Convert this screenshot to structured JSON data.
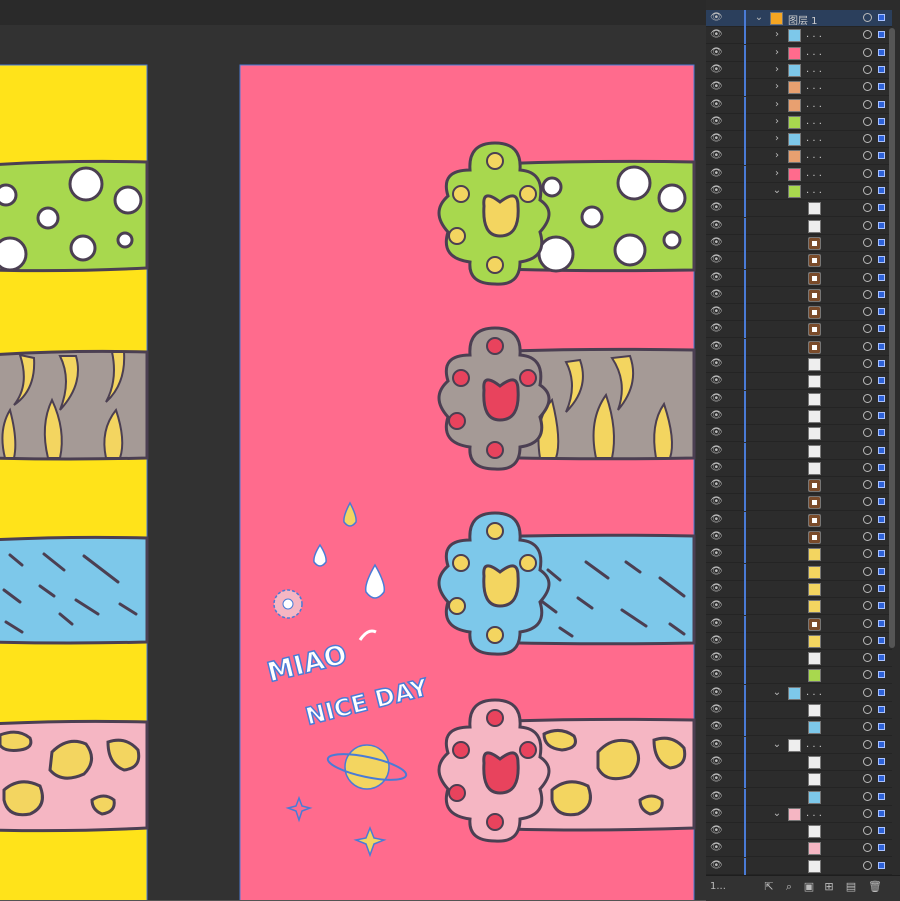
{
  "colors": {
    "canvas_bg": "#323232",
    "artboard_left": "#ffe31a",
    "artboard_right": "#ff6b8d",
    "green_arm": "#a8d84e",
    "gray_arm": "#a59a96",
    "blue_arm": "#7dc8ea",
    "pink_arm": "#f5b6c3",
    "paw_yellow": "#f3d560",
    "paw_red": "#e8435d",
    "selection_blue": "#4a7bd6"
  },
  "artwork": {
    "miao_text": "MIAO",
    "niceday_text": "NICE DAY"
  },
  "layers_panel": {
    "top_layer_name": "图层 1",
    "collapsed_name": ". . .",
    "footer_text": "1...",
    "icons": [
      "eye-icon",
      "chevron-right-icon",
      "chevron-down-icon",
      "target-circle-icon",
      "selection-square-icon",
      "export-icon",
      "search-icon",
      "clip-icon",
      "new-sublayer-icon",
      "new-layer-icon",
      "trash-icon"
    ]
  }
}
